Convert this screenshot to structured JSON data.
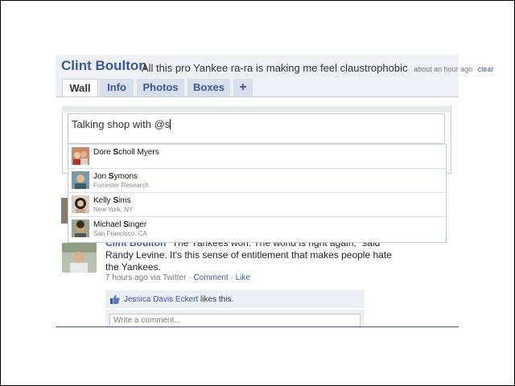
{
  "profile": {
    "name": "Clint Boulton",
    "status": "All this pro Yankee ra-ra is making me feel claustrophobic",
    "time": "about an hour ago",
    "clear": "clear"
  },
  "tabs": [
    {
      "label": "Wall",
      "active": true
    },
    {
      "label": "Info"
    },
    {
      "label": "Photos"
    },
    {
      "label": "Boxes"
    },
    {
      "label": "+"
    }
  ],
  "composer": {
    "value": "Talking shop with @s"
  },
  "suggestions": [
    {
      "pre": "Dore ",
      "match": "S",
      "post": "choll Myers",
      "sub": ""
    },
    {
      "pre": "Jon ",
      "match": "S",
      "post": "ymons",
      "sub": "Forrester Research"
    },
    {
      "pre": "Kelly ",
      "match": "S",
      "post": "ims",
      "sub": "New York, NY"
    },
    {
      "pre": "Michael ",
      "match": "S",
      "post": "inger",
      "sub": "San Francisco, CA"
    }
  ],
  "post": {
    "author": "Clint Boulton",
    "text": " \"The Yankees won. The world is right again,\" said Randy Levine. It's this sense of entitlement that makes people hate the Yankees.",
    "time": "7 hours ago via Twitter",
    "sep": " · ",
    "comment": "Comment",
    "like": "Like"
  },
  "likes": {
    "who": "Jessica Davis Eckert",
    "text": "likes this."
  },
  "comment_box": {
    "placeholder": "Write a comment..."
  },
  "colors": {
    "link": "#3b5998",
    "tab_bg": "#d8dfea",
    "band": "#eef0f6",
    "border": "#bdc7d8"
  }
}
